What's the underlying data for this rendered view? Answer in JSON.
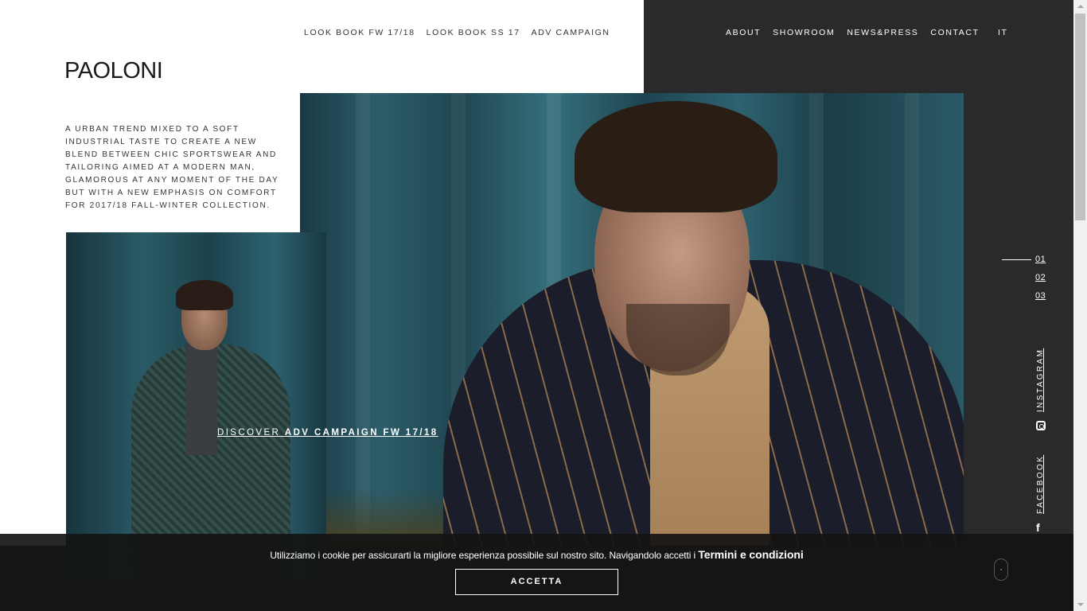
{
  "brand": {
    "logo_text": "PAOLONI"
  },
  "nav_left": [
    {
      "label": "LOOK BOOK FW 17/18"
    },
    {
      "label": "LOOK BOOK SS 17"
    },
    {
      "label": "ADV CAMPAIGN"
    }
  ],
  "nav_right": [
    {
      "label": "ABOUT"
    },
    {
      "label": "SHOWROOM"
    },
    {
      "label": "NEWS&PRESS"
    },
    {
      "label": "CONTACT"
    }
  ],
  "language": {
    "label": "IT"
  },
  "intro": {
    "text": "A URBAN TREND MIXED TO A SOFT INDUSTRIAL TASTE TO CREATE A NEW BLEND BETWEEN CHIC SPORTSWEAR AND TAILORING AIMED AT A MODERN MAN, GLAMOROUS AT ANY MOMENT OF THE DAY BUT WITH A NEW EMPHASIS ON COMFORT FOR 2017/18 FALL-WINTER COLLECTION."
  },
  "hero": {
    "discover_prefix": "DISCOVER",
    "discover_link": "ADV CAMPAIGN FW 17/18"
  },
  "slider": {
    "items": [
      "01",
      "02",
      "03"
    ],
    "active_index": 0
  },
  "social": {
    "instagram": "INSTAGRAM",
    "facebook": "FACEBOOK"
  },
  "cookie": {
    "message": "Utilizziamo i cookie per assicurarti la migliore esperienza possibile sul nostro sito. Navigandolo accetti i",
    "link_label": "Termini e condizioni",
    "button_label": "ACCETTA"
  },
  "colors": {
    "dark_panel": "#2a2a2d",
    "text_dark": "#333333",
    "white": "#ffffff"
  },
  "icons": [
    "instagram-icon",
    "facebook-icon",
    "scroll-down-icon"
  ]
}
